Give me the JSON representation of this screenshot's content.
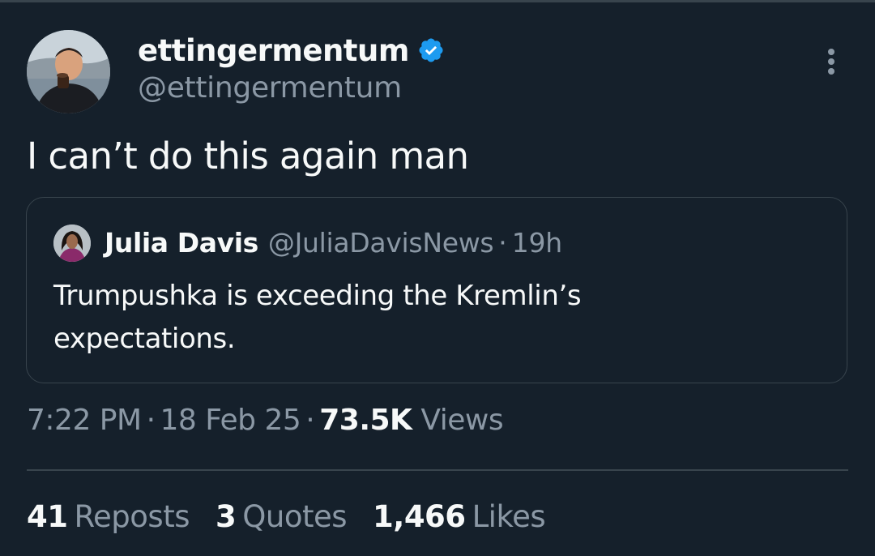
{
  "author": {
    "display_name": "ettingermentum",
    "handle": "@ettingermentum",
    "verified": true
  },
  "tweet": {
    "text": "I can’t do this again man"
  },
  "quoted_tweet": {
    "author_name": "Julia Davis",
    "author_handle": "@JuliaDavisNews",
    "separator": "·",
    "time": "19h",
    "text_line1": "Trumpushka is exceeding the Kremlin’s",
    "text_line2": "expectations."
  },
  "meta": {
    "time": "7:22 PM",
    "separator": "·",
    "date": "18 Feb 25",
    "views_count": "73.5K",
    "views_label": "Views"
  },
  "stats": {
    "reposts_count": "41",
    "reposts_label": "Reposts",
    "quotes_count": "3",
    "quotes_label": "Quotes",
    "likes_count": "1,466",
    "likes_label": "Likes"
  },
  "icons": {
    "verified": "verified-badge-icon",
    "more": "more-options-icon"
  },
  "colors": {
    "background": "#15202b",
    "primary_text": "#f7f9f9",
    "secondary_text": "#8b98a5",
    "border": "#38444d",
    "verified_blue": "#1d9bf0"
  }
}
